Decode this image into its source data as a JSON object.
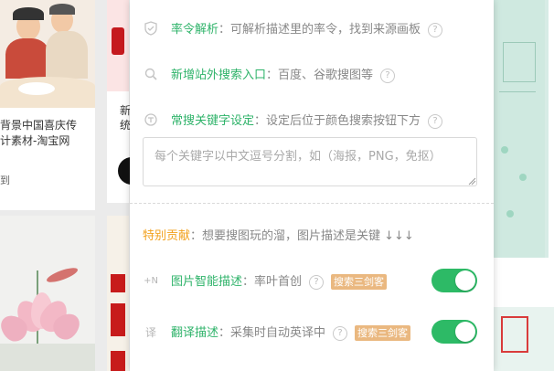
{
  "background": {
    "left_card": {
      "title_line1": "背景中国喜庆传",
      "title_line2": "计素材-淘宝网",
      "meta": "到"
    },
    "mid_card": {
      "line1": "新",
      "line2": "统"
    }
  },
  "panel": {
    "rows": [
      {
        "icon": "shield-icon",
        "title": "率令解析",
        "desc": "：可解析描述里的率令，找到来源画板",
        "help": "?"
      },
      {
        "icon": "search-icon",
        "title": "新增站外搜索入口",
        "desc": "：百度、谷歌搜图等",
        "help": "?"
      },
      {
        "icon": "tag-icon",
        "title": "常搜关键字设定",
        "desc": "：设定后位于颜色搜索按钮下方",
        "help": "?"
      }
    ],
    "keyword_placeholder": "每个关键字以中文逗号分割，如（海报，PNG，免抠）",
    "contrib": {
      "title": "特别贡献",
      "desc": "：想要搜图玩的溜，图片描述是关键 ↓↓↓"
    },
    "features": [
      {
        "icon_text": "+N",
        "title": "图片智能描述",
        "desc": "：率叶首创",
        "help": "?",
        "badge": "搜索三剑客",
        "enabled": true
      },
      {
        "icon_text": "译",
        "title": "翻译描述",
        "desc": "：采集时自动英译中",
        "help": "?",
        "badge": "搜索三剑客",
        "enabled": true
      }
    ]
  },
  "colors": {
    "accent_green": "#2fb36a",
    "toggle_green": "#2dba66",
    "orange_title": "#f2a11d",
    "badge_bg": "#eab880"
  }
}
